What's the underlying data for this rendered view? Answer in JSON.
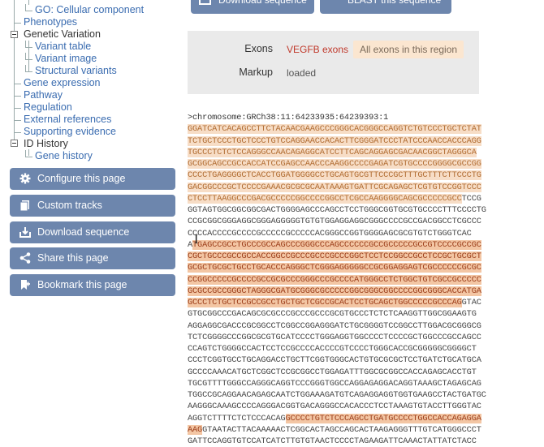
{
  "sidebar": {
    "tree": [
      {
        "label": "GO: Cellular component",
        "level": 2
      },
      {
        "label": "Phenotypes",
        "level": 1
      },
      {
        "label": "Genetic Variation",
        "level": 1,
        "expander": true
      },
      {
        "label": "Variant table",
        "level": 2
      },
      {
        "label": "Variant image",
        "level": 2
      },
      {
        "label": "Structural variants",
        "level": 2
      },
      {
        "label": "Gene expression",
        "level": 1
      },
      {
        "label": "Pathway",
        "level": 1
      },
      {
        "label": "Regulation",
        "level": 1
      },
      {
        "label": "External references",
        "level": 1
      },
      {
        "label": "Supporting evidence",
        "level": 1
      },
      {
        "label": "ID History",
        "level": 1,
        "expander": true
      },
      {
        "label": "Gene history",
        "level": 2
      }
    ],
    "buttons": {
      "configure": "Configure this page",
      "custom_tracks": "Custom tracks",
      "download": "Download sequence",
      "share": "Share this page",
      "bookmark": "Bookmark this page"
    }
  },
  "toolbar": {
    "download_label": "Download sequence",
    "blast_label": "BLAST this sequence"
  },
  "options": {
    "exons_key": "Exons",
    "exons_value": "VEGFB exons",
    "exons_alt": "All exons in this region",
    "markup_key": "Markup",
    "markup_value": "loaded"
  },
  "colors": {
    "button_bg": "#6d86ad",
    "link": "#3a6cb0",
    "exon_selected": "#c0392b",
    "exon_highlight": "#f3c6a4"
  },
  "sequence": {
    "header": ">chromosome:GRCh38:11:64233935:64239393:1",
    "lines": [
      [
        {
          "t": "GGATCATCACAGCCTTCTACAACGAAGCCCGGGCACGGGCCAGGTCTGTCCCTGCTCTAT",
          "c": "ex1"
        }
      ],
      [
        {
          "t": "TCTGCTCCCTGCTCCCTGTCCAGGAACCACACTTCGGGATCCCTATCCCAACCACCCAGG",
          "c": "ex1"
        }
      ],
      [
        {
          "t": "TGCCCTCTCTCCAGGGCCAACAGAGGCATCCTTCAGCAGGAGCGACAACGGCTAGGGCA",
          "c": "ex1"
        }
      ],
      [
        {
          "t": "GCGGCAGCCGCCACCATCCGAGCCAACCCAAGGCCCCGAGATCGTGCCCCGGGGCGCCGG",
          "c": "ex1"
        }
      ],
      [
        {
          "t": "CCCCTGAGGGGCTCACCTGGATGGGGCCTGCAGTGCGTTCCCGCTTTGCTTTCTTCCCTG",
          "c": "ex1"
        }
      ],
      [
        {
          "t": "GACGGCCCGCTCCCCGAAACGCGCGCAATAAAGTGATTCGCAGAGCTCGTGTCCGGTCCC",
          "c": "ex1"
        }
      ],
      [
        {
          "t": "CTCCTTAAGGCCCGACGCCCCCGGCCCCGGCCTCGCCAAGGGGCAGCGCCCCCGCC",
          "c": "ex1"
        },
        {
          "t": "TCCG",
          "c": ""
        }
      ],
      [
        {
          "t": "GGTAGTGGCGGCGGCGACTGGGGAGCCCAGCCTCCTGGGCGGTGCGTGCCCCTTTCCCCTG",
          "c": ""
        }
      ],
      [
        {
          "t": "CCGCGGCGGGAGGCGGGAGGGGGTGTGTGGAGGAGGCGGGCCCCGCCGACGGCCTCGCCC",
          "c": ""
        }
      ],
      [
        {
          "t": "CCCCACCCCGCCCCGCCCCCGCCCCCACGGGCCGGTGGGGAGCGCGTGTCTGGGTCAC",
          "c": ""
        }
      ],
      [
        {
          "t": "A",
          "c": ""
        },
        {
          "t": "TGAGCCGCCTGCCCGCCAGCCCGGGCCCAGCCCCCCGCCGCCCCCGCCGTCCCCGCCGC",
          "c": "ex2"
        }
      ],
      [
        {
          "t": "CGCTGCCCGCCGCCACCGGCCGCCCGCCCGCCCGGCTCCTCCGGCCGCCTCCGCTGCGCT",
          "c": "ex2"
        }
      ],
      [
        {
          "t": "GCGCTGCGCTGCCTGCACCCAGGGCTCGGGAGGGGGCCGCGGAGGAGTCGCCCCCCGCGC",
          "c": "ex2"
        }
      ],
      [
        {
          "t": "CCGGCCCCCGCCCCGCCGCGCCCGGGCCCGCCCCATGGGCCTCTGGCTGTCGCCGCCCCC",
          "c": "ex2"
        }
      ],
      [
        {
          "t": "GCGCCGCCGGGCTAGGGCGATGCGGGCGCCCCCGGCGGGCGGCCCCGGCGGGCACCATGA",
          "c": "ex2"
        }
      ],
      [
        {
          "t": "GCCCTCTGCTCCGCCGCCTGCTGCTCGCCGCACTCCTGCAGCTGGCCCCCGCCCAG",
          "c": "ex2"
        },
        {
          "t": "GTAC",
          "c": ""
        }
      ],
      [
        {
          "t": "GTGCGGCCCGACAGCGCGCCCGCCCGCCCGCGTGCCCTCTCTCAAGGTTGGCGGAAGTG",
          "c": ""
        }
      ],
      [
        {
          "t": "AGGAGGCGACCCGCGGCCTCGGCCGGAGGGATCTGCGGGGTCCGGCCTTGGACGCGGGCG",
          "c": ""
        }
      ],
      [
        {
          "t": "TCTCGGGGCCCGGCGCGTGCATCCCCTGGGAGGTGGCCCCTCCCCGCTGGCCCGCCAGCC",
          "c": ""
        }
      ],
      [
        {
          "t": "CCAGTCTGGGGCCACTCCTCCGCCCCACCCCGTCCCCTGGGCACCGCGGGGGCGGGGCT",
          "c": ""
        }
      ],
      [
        {
          "t": "CCCTCGGTGCCTGCAGGACCTGCTTCGGTGGGCACTGTGCGCGCTCCTGATCTGCATGCA",
          "c": ""
        }
      ],
      [
        {
          "t": "GCCCCAAACATGCTCGGCTCCGCGGCCTGGAGATTTGGCGCGGCCACCAGAGCACCTGT",
          "c": ""
        }
      ],
      [
        {
          "t": "TGCGTTTTGGGCCAGGGCAGGTCCCGGGTGGCCAGGAGAGGACAGGTAAAGCTAGAGCAG",
          "c": ""
        }
      ],
      [
        {
          "t": "TGGCCGCAGGAACAGAGCAATCTGGAAAGATGTCAGAGGAGGTGGTGAAGCCTACTGATGC",
          "c": ""
        }
      ],
      [
        {
          "t": "AAGGGCAAAGCCCCAGGGACGGTGACAGGGCCACACCCTCCTAAAGTGTACCTTGGGTAC",
          "c": ""
        }
      ],
      [
        {
          "t": "AGGTCTTTTCTCTCCCACAG",
          "c": ""
        },
        {
          "t": "GCCCCTGTCTCCCAGCCTGATGCCCCTGGCCACCAGAGGA",
          "c": "ex2"
        }
      ],
      [
        {
          "t": "AAG",
          "c": "ex2"
        },
        {
          "t": "GTAATACTTACAAAAACTCGGCACTAGCCAGCACTAAGAGGGTTTGTCATGGGCCCT",
          "c": ""
        }
      ],
      [
        {
          "t": "GATTCCAGGTGTCCATCATCTTGTGTAACTCCCCTAGAAGATTCAAACTATTATCTACC",
          "c": ""
        }
      ]
    ]
  }
}
